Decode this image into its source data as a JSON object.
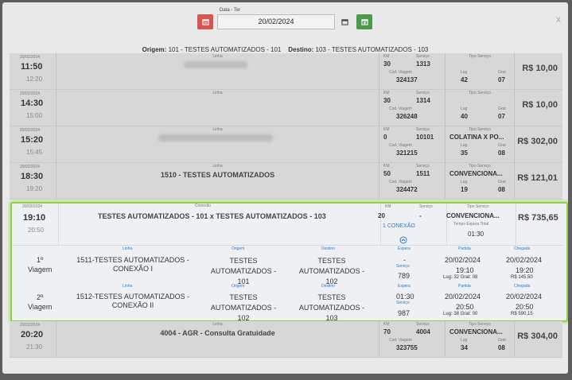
{
  "dialog": {
    "close_label": "x"
  },
  "date_picker": {
    "label": "Data - Ter",
    "value": "20/02/2024"
  },
  "route": {
    "origin_label": "Origem:",
    "origin": "101 - TESTES AUTOMATIZADOS - 101",
    "destination_label": "Destino:",
    "destination": "103 - TESTES AUTOMATIZADOS - 103"
  },
  "labels": {
    "linha": "Linha",
    "km": "KM",
    "servico": "Serviço",
    "tipo_servico": "Tipo Serviço",
    "cod_viagem": "Cod. Viagem",
    "lug": "Lug",
    "grat": "Grat",
    "conexao": "Conexão",
    "tempo_espera_total": "Tempo Espera Total",
    "origem": "Origem",
    "destino": "Destino",
    "espera": "Espera",
    "partida": "Partida",
    "chegada": "Chegada"
  },
  "trips": [
    {
      "date": "20/02/2024",
      "dep": "11:50",
      "arr": "12:20",
      "linha": "",
      "km": "30",
      "servico": "1313",
      "tipo": "",
      "cod": "324137",
      "lug": "42",
      "grat": "07",
      "price": "R$ 10,00"
    },
    {
      "date": "20/02/2024",
      "dep": "14:30",
      "arr": "15:00",
      "linha": "",
      "km": "30",
      "servico": "1314",
      "tipo": "",
      "cod": "326248",
      "lug": "40",
      "grat": "07",
      "price": "R$ 10,00"
    },
    {
      "date": "20/02/2024",
      "dep": "15:20",
      "arr": "15:45",
      "linha": "",
      "km": "0",
      "servico": "10101",
      "tipo": "COLATINA X PO...",
      "cod": "321215",
      "lug": "35",
      "grat": "08",
      "price": "R$ 302,00"
    },
    {
      "date": "20/02/2024",
      "dep": "18:30",
      "arr": "19:20",
      "linha": "1510 - TESTES AUTOMATIZADOS",
      "km": "50",
      "servico": "1511",
      "tipo": "CONVENCIONA...",
      "cod": "324472",
      "lug": "19",
      "grat": "08",
      "price": "R$ 121,01"
    },
    {
      "date": "20/02/2024",
      "dep": "20:20",
      "arr": "21:30",
      "linha": "4004 - AGR - Consulta Gratuidade",
      "km": "70",
      "servico": "4004",
      "tipo": "CONVENCIONA...",
      "cod": "323755",
      "lug": "34",
      "grat": "08",
      "price": "R$ 304,00"
    }
  ],
  "connection": {
    "date": "20/02/2024",
    "dep": "19:10",
    "arr": "20:50",
    "title": "TESTES AUTOMATIZADOS - 101 x TESTES AUTOMATIZADOS - 103",
    "km": "20",
    "servico": "-",
    "badge": "1 CONEXÃO",
    "tipo": "CONVENCIONA...",
    "espera_total": "01:30",
    "price": "R$ 735,65",
    "legs": [
      {
        "n": "1º",
        "viagem": "Viagem",
        "linha": "1511-TESTES AUTOMATIZADOS - CONEXÃO I",
        "origem": "TESTES AUTOMATIZADOS - 101",
        "destino": "TESTES AUTOMATIZADOS - 102",
        "espera": "-",
        "servico": "789",
        "partida_date": "20/02/2024",
        "partida_time": "19:10",
        "lug_grat": "Lug: 32 Grat: 08",
        "chegada_date": "20/02/2024",
        "chegada_time": "19:20",
        "valor": "R$ 145,50"
      },
      {
        "n": "2º",
        "viagem": "Viagem",
        "linha": "1512-TESTES AUTOMATIZADOS - CONEXÃO II",
        "origem": "TESTES AUTOMATIZADOS - 102",
        "destino": "TESTES AUTOMATIZADOS - 103",
        "espera": "01:30",
        "servico": "987",
        "partida_date": "20/02/2024",
        "partida_time": "20:50",
        "lug_grat": "Lug: 38 Grat: 00",
        "chegada_date": "20/02/2024",
        "chegada_time": "20:50",
        "valor": "R$ 590,15"
      }
    ]
  },
  "colors": {
    "highlight_border": "#8fd14f",
    "prev_button": "#d9534f",
    "next_button": "#4a9a4a",
    "link_blue": "#2a7dc9"
  },
  "icons": {
    "prev": "calendar-minus-icon",
    "next": "calendar-plus-icon",
    "calendar": "calendar-icon",
    "expand": "expand-circle-icon"
  }
}
